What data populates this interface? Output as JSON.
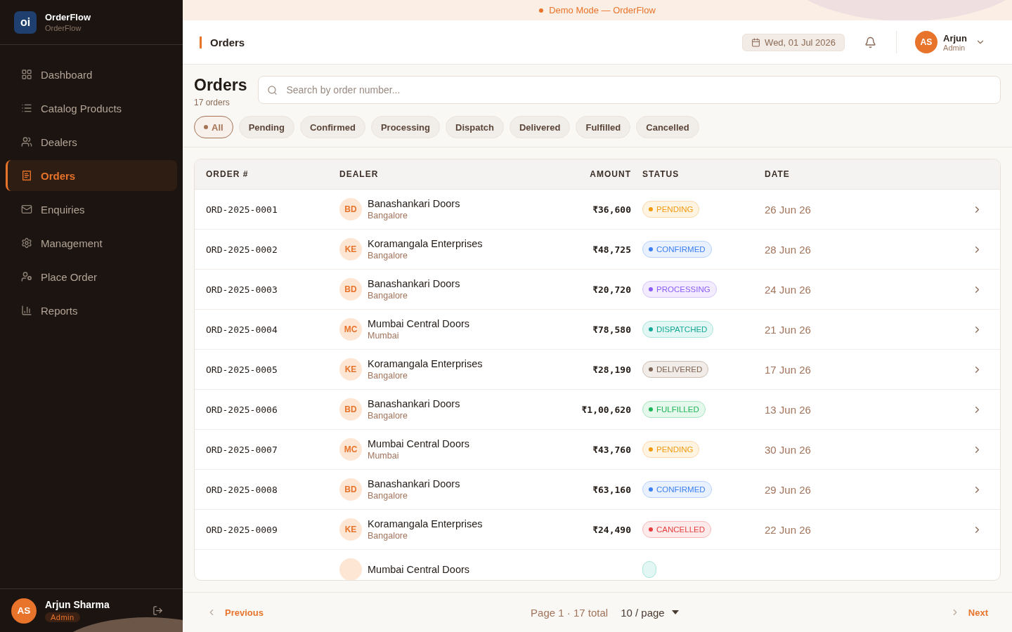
{
  "brand": {
    "logo": "oi",
    "name": "OrderFlow",
    "subtitle": "OrderFlow"
  },
  "nav": [
    {
      "label": "Dashboard",
      "selected": false
    },
    {
      "label": "Catalog Products",
      "selected": false
    },
    {
      "label": "Dealers",
      "selected": false
    },
    {
      "label": "Orders",
      "selected": true
    },
    {
      "label": "Enquiries",
      "selected": false
    },
    {
      "label": "Management",
      "selected": false
    },
    {
      "label": "Place Order",
      "selected": false
    },
    {
      "label": "Reports",
      "selected": false
    }
  ],
  "sidebar_user": {
    "initials": "AS",
    "name": "Arjun Sharma",
    "role": "Admin"
  },
  "banner": "Demo Mode — OrderFlow",
  "header": {
    "title": "Orders",
    "date": "Wed, 01 Jul 2026",
    "user": {
      "initials": "AS",
      "name": "Arjun",
      "role": "Admin"
    }
  },
  "page": {
    "title": "Orders",
    "count": "17 orders",
    "search": {
      "placeholder": "Search by order number..."
    }
  },
  "filters": [
    {
      "label": "All",
      "selected": true
    },
    {
      "label": "Pending",
      "selected": false
    },
    {
      "label": "Confirmed",
      "selected": false
    },
    {
      "label": "Processing",
      "selected": false
    },
    {
      "label": "Dispatch",
      "selected": false
    },
    {
      "label": "Delivered",
      "selected": false
    },
    {
      "label": "Fulfilled",
      "selected": false
    },
    {
      "label": "Cancelled",
      "selected": false
    }
  ],
  "table": {
    "columns": [
      "ORDER #",
      "DEALER",
      "AMOUNT",
      "STATUS",
      "DATE"
    ],
    "rows": [
      {
        "order": "ORD-2025-0001",
        "initials": "BD",
        "dealer": "Banashankari Doors",
        "city": "Bangalore",
        "amount": "₹36,600",
        "status": {
          "kind": "pending",
          "label": "PENDING"
        },
        "date": "26 Jun 26"
      },
      {
        "order": "ORD-2025-0002",
        "initials": "KE",
        "dealer": "Koramangala Enterprises",
        "city": "Bangalore",
        "amount": "₹48,725",
        "status": {
          "kind": "confirmed",
          "label": "CONFIRMED"
        },
        "date": "28 Jun 26"
      },
      {
        "order": "ORD-2025-0003",
        "initials": "BD",
        "dealer": "Banashankari Doors",
        "city": "Bangalore",
        "amount": "₹20,720",
        "status": {
          "kind": "processing",
          "label": "PROCESSING"
        },
        "date": "24 Jun 26"
      },
      {
        "order": "ORD-2025-0004",
        "initials": "MC",
        "dealer": "Mumbai Central Doors",
        "city": "Mumbai",
        "amount": "₹78,580",
        "status": {
          "kind": "dispatched",
          "label": "DISPATCHED"
        },
        "date": "21 Jun 26"
      },
      {
        "order": "ORD-2025-0005",
        "initials": "KE",
        "dealer": "Koramangala Enterprises",
        "city": "Bangalore",
        "amount": "₹28,190",
        "status": {
          "kind": "delivered",
          "label": "DELIVERED"
        },
        "date": "17 Jun 26"
      },
      {
        "order": "ORD-2025-0006",
        "initials": "BD",
        "dealer": "Banashankari Doors",
        "city": "Bangalore",
        "amount": "₹1,00,620",
        "status": {
          "kind": "fulfilled",
          "label": "FULFILLED"
        },
        "date": "13 Jun 26"
      },
      {
        "order": "ORD-2025-0007",
        "initials": "MC",
        "dealer": "Mumbai Central Doors",
        "city": "Mumbai",
        "amount": "₹43,760",
        "status": {
          "kind": "pending",
          "label": "PENDING"
        },
        "date": "30 Jun 26"
      },
      {
        "order": "ORD-2025-0008",
        "initials": "BD",
        "dealer": "Banashankari Doors",
        "city": "Bangalore",
        "amount": "₹63,160",
        "status": {
          "kind": "confirmed",
          "label": "CONFIRMED"
        },
        "date": "29 Jun 26"
      },
      {
        "order": "ORD-2025-0009",
        "initials": "KE",
        "dealer": "Koramangala Enterprises",
        "city": "Bangalore",
        "amount": "₹24,490",
        "status": {
          "kind": "cancelled",
          "label": "CANCELLED"
        },
        "date": "22 Jun 26"
      },
      {
        "dealer": "Mumbai Central Doors",
        "status": {
          "kind": "dispatched"
        }
      }
    ]
  },
  "pagination": {
    "previous": "Previous",
    "info": "Page 1 · 17 total",
    "page_size": "10 / page",
    "next": "Next"
  }
}
